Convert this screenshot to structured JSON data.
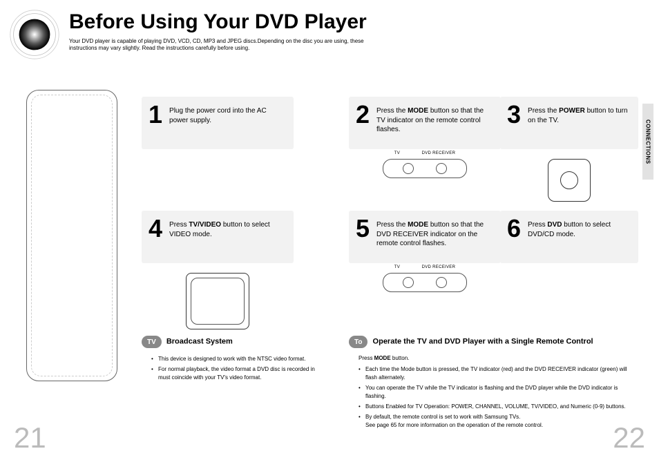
{
  "header": {
    "title": "Before Using Your DVD Player",
    "subtitle": "Your DVD player is capable of playing DVD, VCD, CD, MP3 and JPEG discs.Depending on the disc you are using, these instructions may vary slightly. Read the instructions carefully before using."
  },
  "sidebar": {
    "label": "CONNECTIONS"
  },
  "steps": {
    "s1": {
      "num": "1",
      "pre": "Plug the power cord into the AC power supply."
    },
    "s2": {
      "num": "2",
      "pre": "Press the ",
      "bold": "MODE",
      "post": " button so that the TV indicator on the remote control flashes."
    },
    "s3": {
      "num": "3",
      "pre": "Press the ",
      "bold": "POWER",
      "post": " button to turn on the TV."
    },
    "s4": {
      "num": "4",
      "pre": "Press ",
      "bold": "TV/VIDEO",
      "post": " button to select VIDEO mode."
    },
    "s5": {
      "num": "5",
      "pre": "Press the ",
      "bold": "MODE",
      "post": " button so that the DVD RECEIVER indicator on the remote control flashes."
    },
    "s6": {
      "num": "6",
      "pre": "Press ",
      "bold": "DVD",
      "post": " button to select DVD/CD mode."
    }
  },
  "pill_labels": {
    "tv": "TV",
    "dvd": "DVD RECEIVER"
  },
  "tv_section": {
    "chip": "TV",
    "title": " Broadcast System",
    "b1": "This device is designed to work with the NTSC video format.",
    "b2": "For normal playback, the video format a DVD disc is recorded in must coincide with your TV's video format."
  },
  "to_section": {
    "chip": "To",
    "title": " Operate the TV and DVD Player with a Single Remote Control",
    "press_pre": "Press ",
    "press_bold": "MODE",
    "press_post": " button.",
    "b1": "Each time the Mode button is pressed, the TV indicator (red) and the DVD RECEIVER indicator (green) will flash alternately.",
    "b2": "You can operate the TV while the TV indicator is flashing and the DVD player while the DVD indicator is flashing.",
    "b3": "Buttons Enabled for TV Operation: POWER, CHANNEL, VOLUME, TV/VIDEO, and Numeric (0-9) buttons.",
    "b4a": "By default, the remote control is set to work with Samsung TVs.",
    "b4b": "See page 65 for more information on the operation of the remote control."
  },
  "pages": {
    "left": "21",
    "right": "22"
  }
}
